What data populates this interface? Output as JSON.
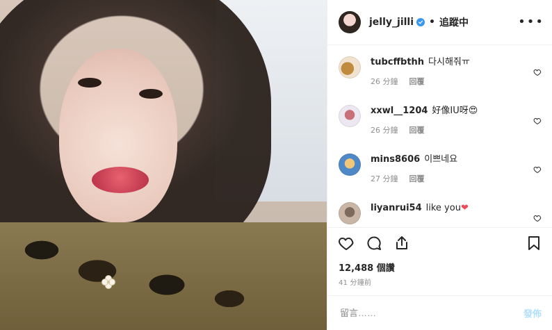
{
  "header": {
    "username": "jelly_jilli",
    "separator": "•",
    "follow_state": "追蹤中",
    "more_label": "•••"
  },
  "comments": [
    {
      "username": "tubcffbthh",
      "text": "다시해줘ㅠ",
      "time": "26 分鐘",
      "reply": "回覆"
    },
    {
      "username": "xxwl__1204",
      "text": "好像IU呀",
      "emoji": "😍",
      "time": "26 分鐘",
      "reply": "回覆"
    },
    {
      "username": "mins8606",
      "text": "이쁘네요",
      "time": "27 分鐘",
      "reply": "回覆"
    },
    {
      "username": "liyanrui54",
      "text": "like you",
      "emoji": "❤",
      "time": "",
      "reply": ""
    }
  ],
  "stats": {
    "likes": "12,488 個讚",
    "time_ago": "41 分鐘前"
  },
  "composer": {
    "placeholder": "留言……",
    "post_label": "發佈"
  },
  "colors": {
    "verified": "#3897f0",
    "post_disabled": "#b2dffc",
    "muted": "#8e8e8e",
    "text": "#262626"
  },
  "icons": {
    "like": "heart-outline-icon",
    "comment": "comment-bubble-icon",
    "share": "share-upload-icon",
    "save": "bookmark-icon"
  }
}
